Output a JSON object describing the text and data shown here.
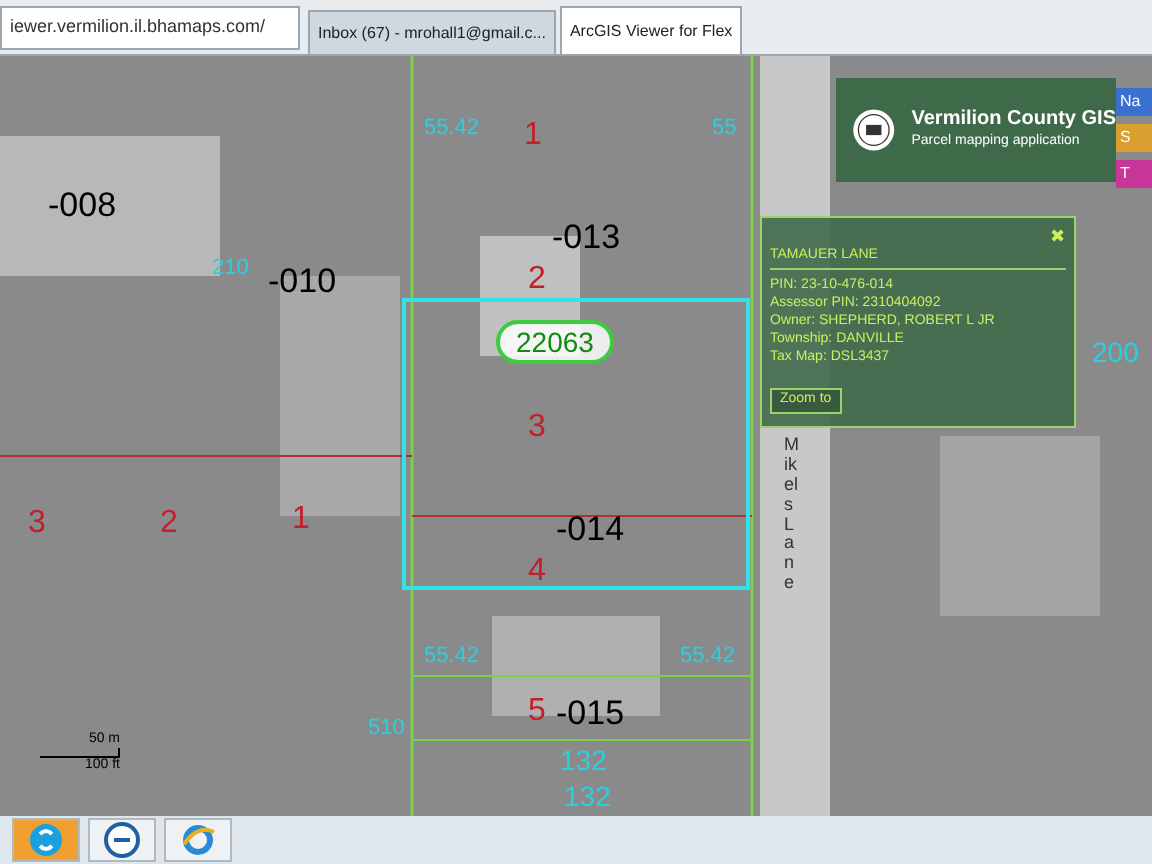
{
  "browser": {
    "address": "iewer.vermilion.il.bhamaps.com/",
    "tabs": [
      {
        "label": "Inbox (67) - mrohall1@gmail.c...",
        "selected": false
      },
      {
        "label": "ArcGIS Viewer for Flex",
        "selected": true
      }
    ]
  },
  "header": {
    "title": "Vermilion County GIS",
    "subtitle": "Parcel mapping application",
    "side_buttons": [
      {
        "label": "Na",
        "color": "#3b6fd0"
      },
      {
        "label": "S",
        "color": "#d9a030"
      },
      {
        "label": "T",
        "color": "#c8369a"
      }
    ]
  },
  "map_labels": [
    {
      "text": "-008",
      "kind": "parcel"
    },
    {
      "text": "-010",
      "kind": "parcel"
    },
    {
      "text": "-013",
      "kind": "parcel"
    },
    {
      "text": "-014",
      "kind": "parcel"
    },
    {
      "text": "-015",
      "kind": "parcel"
    },
    {
      "text": "1",
      "kind": "lot"
    },
    {
      "text": "2",
      "kind": "lot"
    },
    {
      "text": "3",
      "kind": "lot"
    },
    {
      "text": "4",
      "kind": "lot"
    },
    {
      "text": "5",
      "kind": "lot"
    },
    {
      "text": "3",
      "kind": "lot"
    },
    {
      "text": "2",
      "kind": "lot"
    },
    {
      "text": "1",
      "kind": "lot"
    },
    {
      "text": "200",
      "kind": "dimension"
    },
    {
      "text": "132",
      "kind": "dimension"
    },
    {
      "text": "132",
      "kind": "dimension"
    },
    {
      "text": "55.42",
      "kind": "vertical"
    },
    {
      "text": "55",
      "kind": "vertical"
    },
    {
      "text": "210",
      "kind": "vertical"
    },
    {
      "text": "510",
      "kind": "vertical"
    },
    {
      "text": "55.42",
      "kind": "vertical"
    },
    {
      "text": "55.42",
      "kind": "vertical"
    }
  ],
  "parcel_tag": "22063",
  "popup": {
    "close": "✖",
    "title": "TAMAUER LANE",
    "lines": [
      "PIN: 23-10-476-014",
      "Assessor PIN: 2310404092",
      "Owner: SHEPHERD, ROBERT L JR",
      "Township: DANVILLE",
      "Tax Map: DSL3437"
    ],
    "button": "Zoom to"
  },
  "street": "Mikels Lane",
  "scale": {
    "metric": "50 m",
    "imperial": "100 ft"
  },
  "taskbar": [
    {
      "kind": "skype",
      "selected": true
    },
    {
      "kind": "dell",
      "selected": false
    },
    {
      "kind": "ie",
      "selected": false
    }
  ]
}
